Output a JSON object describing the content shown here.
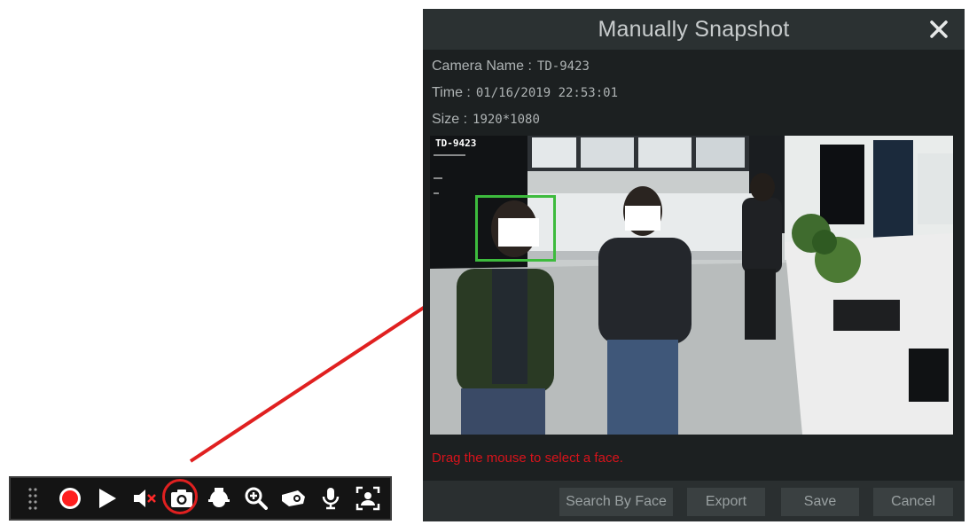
{
  "dialog": {
    "title": "Manually Snapshot",
    "camera_name_label": "Camera Name :",
    "camera_name_value": "TD-9423",
    "time_label": "Time :",
    "time_value": "01/16/2019 22:53:01",
    "size_label": "Size :",
    "size_value": "1920*1080",
    "image_overlay_text": "TD-9423",
    "hint": "Drag the mouse to select a face.",
    "buttons": {
      "search_by_face": "Search By Face",
      "export": "Export",
      "save": "Save",
      "cancel": "Cancel"
    }
  },
  "toolbar": {
    "items": [
      "drag-handle-icon",
      "record-icon",
      "play-icon",
      "mute-icon",
      "snapshot-icon",
      "ptz-dome-icon",
      "zoom-in-icon",
      "3d-zoom-icon",
      "microphone-icon",
      "face-detect-icon"
    ],
    "highlighted": "snapshot-icon"
  },
  "colors": {
    "dialog_bg": "#1c2021",
    "header_bg": "#2b3132",
    "hint_red": "#d8131b",
    "face_box_green": "#3dbb3d",
    "arrow_red": "#e02020",
    "record_red": "#ff1e1e"
  }
}
